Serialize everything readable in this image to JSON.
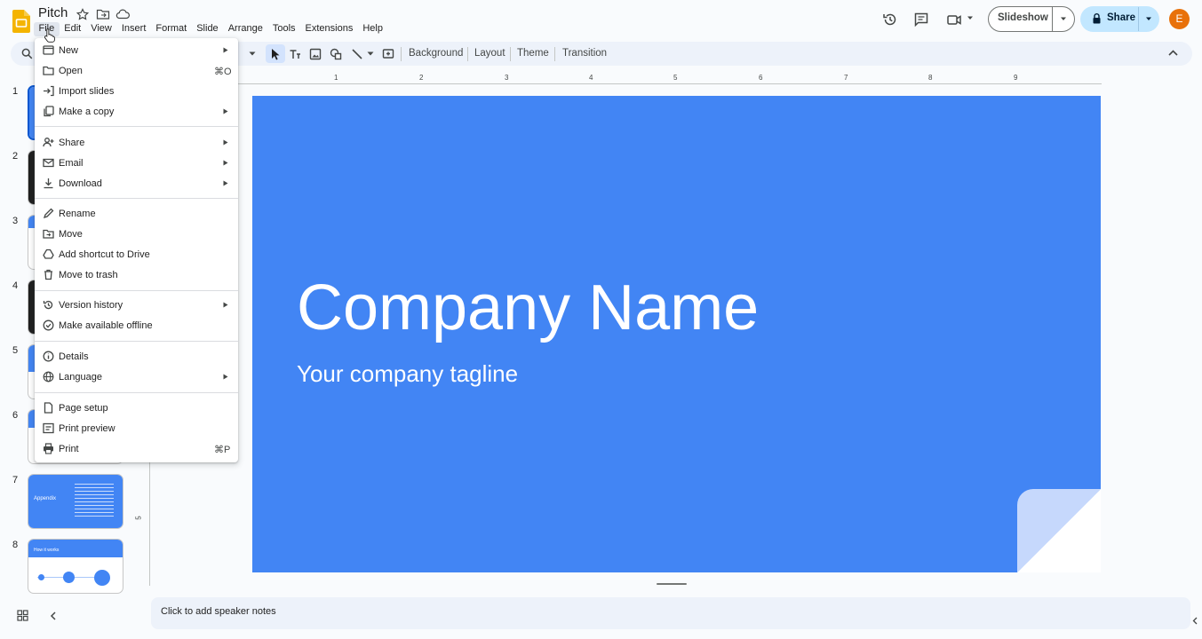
{
  "app": {
    "doc_title": "Pitch",
    "avatar_initial": "E"
  },
  "menubar": [
    "File",
    "Edit",
    "View",
    "Insert",
    "Format",
    "Slide",
    "Arrange",
    "Tools",
    "Extensions",
    "Help"
  ],
  "header": {
    "slideshow_label": "Slideshow",
    "share_label": "Share"
  },
  "toolbar": {
    "background_label": "Background",
    "layout_label": "Layout",
    "theme_label": "Theme",
    "transition_label": "Transition"
  },
  "ruler": {
    "horizontal": [
      "1",
      "2",
      "3",
      "4",
      "5",
      "6",
      "7",
      "8",
      "9"
    ],
    "vertical": [
      "5"
    ]
  },
  "filmstrip": {
    "slide_numbers": [
      "1",
      "2",
      "3",
      "4",
      "5",
      "6",
      "7",
      "8"
    ],
    "slide7_title": "Appendix",
    "slide8_title": "How it works"
  },
  "slide": {
    "title": "Company Name",
    "tagline": "Your company tagline"
  },
  "notes": {
    "placeholder": "Click to add speaker notes"
  },
  "file_menu": {
    "items": [
      {
        "label": "New",
        "icon": "new-icon"
      },
      {
        "label": "Open",
        "shortcut": "⌘O",
        "icon": "folder-icon"
      },
      {
        "label": "Import slides",
        "icon": "import-icon"
      },
      {
        "label": "Make a copy",
        "icon": "copy-icon"
      },
      {
        "label": "Share",
        "icon": "share-person-icon"
      },
      {
        "label": "Email",
        "icon": "email-icon"
      },
      {
        "label": "Download",
        "icon": "download-icon"
      },
      {
        "label": "Rename",
        "icon": "rename-icon"
      },
      {
        "label": "Move",
        "icon": "move-folder-icon"
      },
      {
        "label": "Add shortcut to Drive",
        "icon": "drive-shortcut-icon"
      },
      {
        "label": "Move to trash",
        "icon": "trash-icon"
      },
      {
        "label": "Version history",
        "icon": "history-icon"
      },
      {
        "label": "Make available offline",
        "icon": "offline-icon"
      },
      {
        "label": "Details",
        "icon": "info-icon"
      },
      {
        "label": "Language",
        "icon": "globe-icon"
      },
      {
        "label": "Page setup",
        "icon": "page-setup-icon"
      },
      {
        "label": "Print preview",
        "icon": "print-preview-icon"
      },
      {
        "label": "Print",
        "shortcut": "⌘P",
        "icon": "print-icon"
      }
    ]
  },
  "colors": {
    "slide_background": "#4285f4",
    "share_button": "#c2e7ff",
    "selection_accent": "#0b57d0",
    "avatar": "#e8710a"
  }
}
